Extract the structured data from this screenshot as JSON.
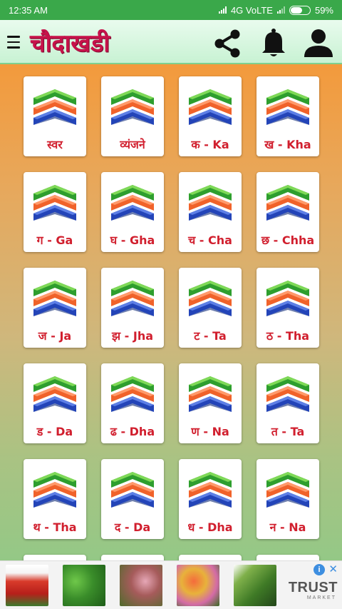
{
  "status_bar": {
    "time": "12:35 AM",
    "network": "4G VoLTE",
    "battery": "59%",
    "battery_level": 0.59
  },
  "app_bar": {
    "title": "चौदाखडी",
    "icons": [
      "menu-icon",
      "share-icon",
      "bell-icon",
      "user-icon"
    ]
  },
  "grid": {
    "items": [
      {
        "label": "स्वर"
      },
      {
        "label": "व्यंजने"
      },
      {
        "label": "क - Ka"
      },
      {
        "label": "ख - Kha"
      },
      {
        "label": "ग - Ga"
      },
      {
        "label": "घ - Gha"
      },
      {
        "label": "च - Cha"
      },
      {
        "label": "छ - Chha"
      },
      {
        "label": "ज - Ja"
      },
      {
        "label": "झ - Jha"
      },
      {
        "label": "ट - Ta"
      },
      {
        "label": "ठ - Tha"
      },
      {
        "label": "ड - Da"
      },
      {
        "label": "ढ - Dha"
      },
      {
        "label": "ण - Na"
      },
      {
        "label": "त - Ta"
      },
      {
        "label": "थ - Tha"
      },
      {
        "label": "द - Da"
      },
      {
        "label": "ध - Dha"
      },
      {
        "label": "न - Na"
      }
    ]
  },
  "ad": {
    "brand": "TRUST",
    "brand_sub": "MARKET",
    "info_glyph": "i",
    "close_glyph": "✕"
  },
  "colors": {
    "status_bar": "#3aa84a",
    "title": "#c6124a",
    "card_label": "#d11f2e",
    "chevron_green": "#2e9e2e",
    "chevron_orange": "#f0622a",
    "chevron_blue": "#2344b8"
  }
}
